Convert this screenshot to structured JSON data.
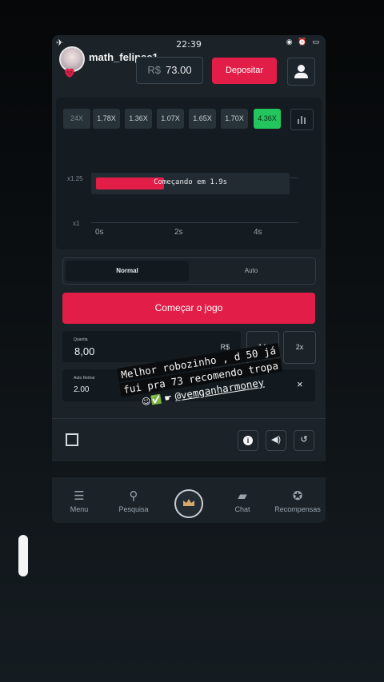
{
  "status": {
    "time": "22:39"
  },
  "header": {
    "username": "math_felipee1",
    "currency": "R$",
    "balance": "73.00",
    "deposit_label": "Depositar"
  },
  "game": {
    "multipliers": [
      "24X",
      "1.78X",
      "1.36X",
      "1.07X",
      "1.65X",
      "1.70X",
      "4.36X"
    ],
    "y_labels": [
      "x1.25",
      "x1"
    ],
    "x_labels": [
      "0s",
      "2s",
      "4s"
    ],
    "starting_text": "Começando em 1.9s",
    "countdown_progress": 0.36
  },
  "bet": {
    "tabs": {
      "normal": "Normal",
      "auto": "Auto"
    },
    "start_label": "Começar o jogo",
    "quantity_label": "Quantia",
    "quantity_value": "8,00",
    "quantity_currency": "R$",
    "half_label": "½",
    "double_label": "2x",
    "auto_label": "Auto Retirar",
    "auto_value": "2.00"
  },
  "nav": {
    "menu": "Menu",
    "search": "Pesquisa",
    "chat": "Chat",
    "rewards": "Recompensas"
  },
  "overlay": {
    "line1": "Melhor robozinho , d 50 já",
    "line2": "fui pra 73 recomendo tropa",
    "handle": "@vemganharmoney"
  },
  "colors": {
    "accent": "#e11d48",
    "win": "#22c55e",
    "panel": "#1b2329"
  },
  "icons": [
    "airplane-icon",
    "user-icon",
    "stats-icon",
    "expand-icon",
    "info-icon",
    "sound-icon",
    "history-icon",
    "menu-icon",
    "search-icon",
    "crown-icon",
    "chat-icon",
    "rewards-icon",
    "close-icon"
  ]
}
